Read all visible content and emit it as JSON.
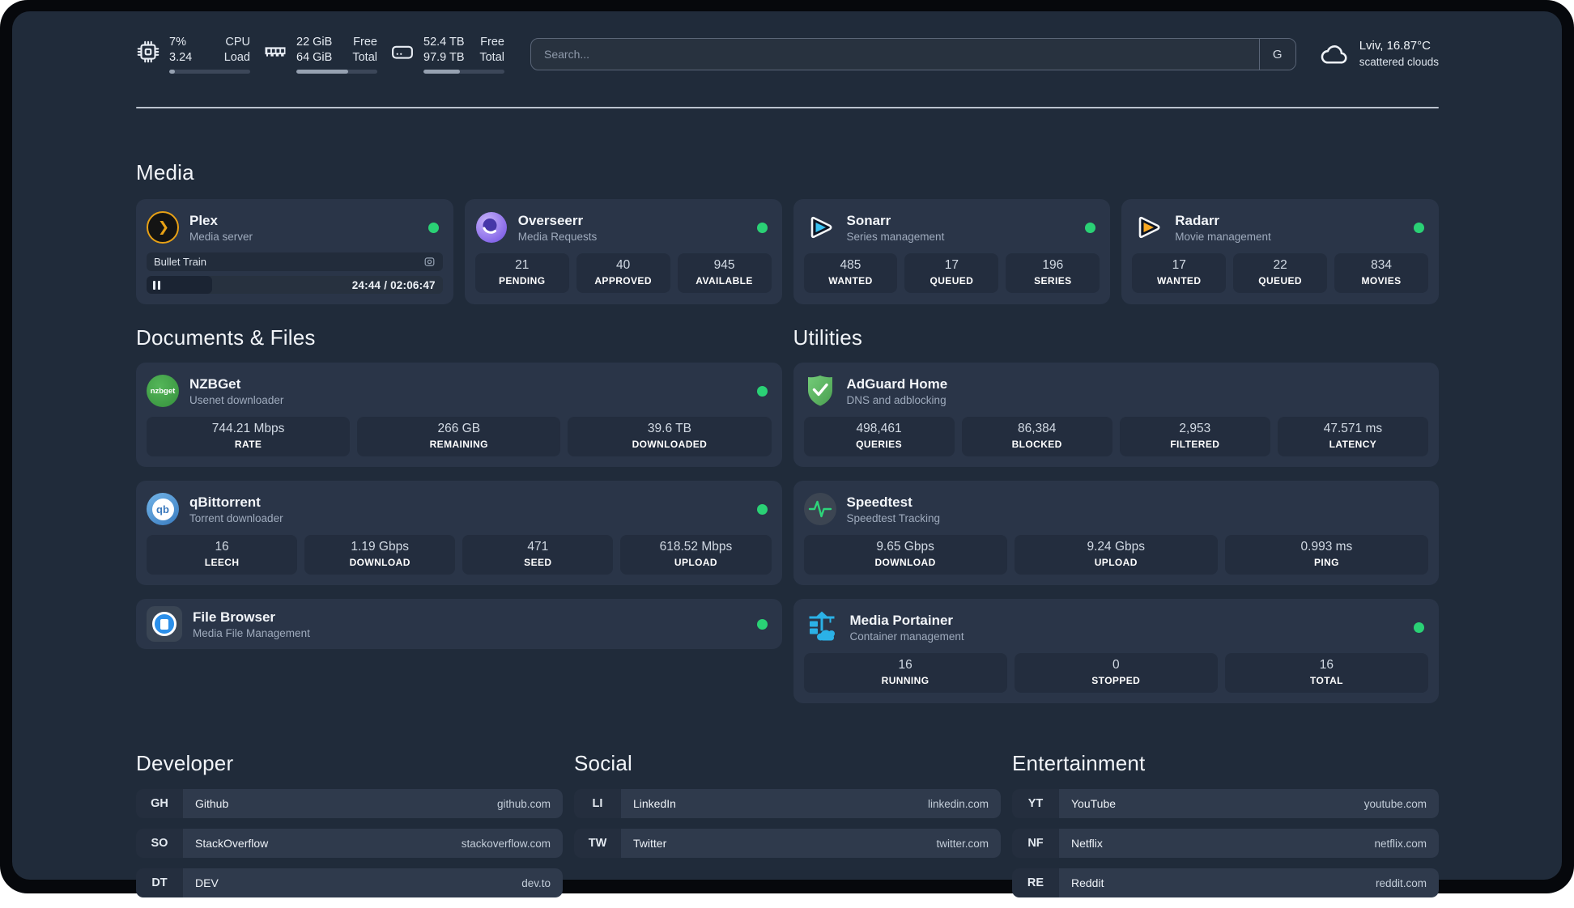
{
  "header": {
    "metrics": [
      {
        "icon": "cpu-icon",
        "values": [
          "7%",
          "3.24"
        ],
        "labels": [
          "CPU",
          "Load"
        ],
        "progress": 7
      },
      {
        "icon": "ram-icon",
        "values": [
          "22 GiB",
          "64 GiB"
        ],
        "labels": [
          "Free",
          "Total"
        ],
        "progress": 64
      },
      {
        "icon": "disk-icon",
        "values": [
          "52.4 TB",
          "97.9 TB"
        ],
        "labels": [
          "Free",
          "Total"
        ],
        "progress": 45
      }
    ],
    "search": {
      "placeholder": "Search...",
      "engine_label": "G"
    },
    "weather": {
      "location_temp": "Lviv, 16.87°C",
      "condition": "scattered clouds"
    }
  },
  "media": {
    "title": "Media",
    "plex": {
      "title": "Plex",
      "subtitle": "Media server",
      "icon": "plex-icon",
      "online": true,
      "now_playing": {
        "title": "Bullet Train",
        "time": "24:44 / 02:06:47",
        "progress": 20
      }
    },
    "overseerr": {
      "title": "Overseerr",
      "subtitle": "Media Requests",
      "icon": "overseerr-icon",
      "online": true,
      "stats": [
        {
          "value": "21",
          "label": "PENDING"
        },
        {
          "value": "40",
          "label": "APPROVED"
        },
        {
          "value": "945",
          "label": "AVAILABLE"
        }
      ]
    },
    "sonarr": {
      "title": "Sonarr",
      "subtitle": "Series management",
      "icon": "sonarr-icon",
      "online": true,
      "stats": [
        {
          "value": "485",
          "label": "WANTED"
        },
        {
          "value": "17",
          "label": "QUEUED"
        },
        {
          "value": "196",
          "label": "SERIES"
        }
      ]
    },
    "radarr": {
      "title": "Radarr",
      "subtitle": "Movie management",
      "icon": "radarr-icon",
      "online": true,
      "stats": [
        {
          "value": "17",
          "label": "WANTED"
        },
        {
          "value": "22",
          "label": "QUEUED"
        },
        {
          "value": "834",
          "label": "MOVIES"
        }
      ]
    }
  },
  "documents": {
    "title": "Documents & Files",
    "nzbget": {
      "title": "NZBGet",
      "subtitle": "Usenet downloader",
      "icon": "nzbget-icon",
      "online": true,
      "stats": [
        {
          "value": "744.21 Mbps",
          "label": "RATE"
        },
        {
          "value": "266 GB",
          "label": "REMAINING"
        },
        {
          "value": "39.6 TB",
          "label": "DOWNLOADED"
        }
      ]
    },
    "qbittorrent": {
      "title": "qBittorrent",
      "subtitle": "Torrent downloader",
      "icon": "qbittorrent-icon",
      "online": true,
      "stats": [
        {
          "value": "16",
          "label": "LEECH"
        },
        {
          "value": "1.19 Gbps",
          "label": "DOWNLOAD"
        },
        {
          "value": "471",
          "label": "SEED"
        },
        {
          "value": "618.52 Mbps",
          "label": "UPLOAD"
        }
      ]
    },
    "filebrowser": {
      "title": "File Browser",
      "subtitle": "Media File Management",
      "icon": "filebrowser-icon",
      "online": true
    }
  },
  "utilities": {
    "title": "Utilities",
    "adguard": {
      "title": "AdGuard Home",
      "subtitle": "DNS and adblocking",
      "icon": "adguard-icon",
      "stats": [
        {
          "value": "498,461",
          "label": "QUERIES"
        },
        {
          "value": "86,384",
          "label": "BLOCKED"
        },
        {
          "value": "2,953",
          "label": "FILTERED"
        },
        {
          "value": "47.571 ms",
          "label": "LATENCY"
        }
      ]
    },
    "speedtest": {
      "title": "Speedtest",
      "subtitle": "Speedtest Tracking",
      "icon": "speedtest-icon",
      "stats": [
        {
          "value": "9.65 Gbps",
          "label": "DOWNLOAD"
        },
        {
          "value": "9.24 Gbps",
          "label": "UPLOAD"
        },
        {
          "value": "0.993 ms",
          "label": "PING"
        }
      ]
    },
    "portainer": {
      "title": "Media Portainer",
      "subtitle": "Container management",
      "icon": "portainer-icon",
      "online": true,
      "stats": [
        {
          "value": "16",
          "label": "RUNNING"
        },
        {
          "value": "0",
          "label": "STOPPED"
        },
        {
          "value": "16",
          "label": "TOTAL"
        }
      ]
    }
  },
  "bookmarks": {
    "developer": {
      "title": "Developer",
      "items": [
        {
          "abbr": "GH",
          "name": "Github",
          "url": "github.com"
        },
        {
          "abbr": "SO",
          "name": "StackOverflow",
          "url": "stackoverflow.com"
        },
        {
          "abbr": "DT",
          "name": "DEV",
          "url": "dev.to"
        }
      ]
    },
    "social": {
      "title": "Social",
      "items": [
        {
          "abbr": "LI",
          "name": "LinkedIn",
          "url": "linkedin.com"
        },
        {
          "abbr": "TW",
          "name": "Twitter",
          "url": "twitter.com"
        }
      ]
    },
    "entertainment": {
      "title": "Entertainment",
      "items": [
        {
          "abbr": "YT",
          "name": "YouTube",
          "url": "youtube.com"
        },
        {
          "abbr": "NF",
          "name": "Netflix",
          "url": "netflix.com"
        },
        {
          "abbr": "RE",
          "name": "Reddit",
          "url": "reddit.com"
        }
      ]
    }
  }
}
